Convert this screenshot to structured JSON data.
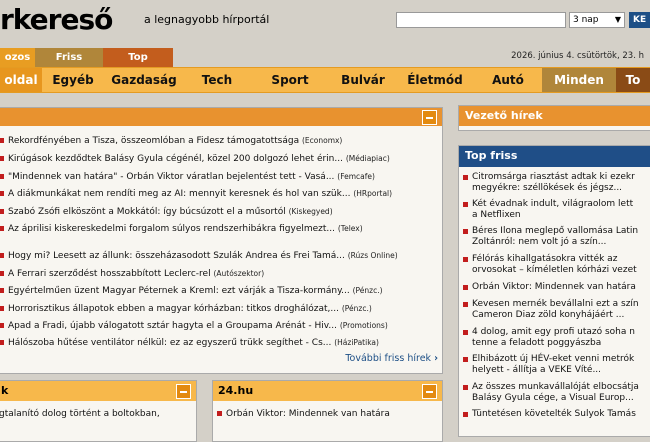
{
  "header": {
    "logo": "rkereső",
    "tagline": "a legnagyobb hírportál",
    "top_note": "hírek itt",
    "search_placeholder": "",
    "days_selected": "3 nap",
    "search_button": "KE"
  },
  "tabs": [
    {
      "label": "ozos",
      "color": "#e89d22"
    },
    {
      "label": "Friss",
      "color": "#b0863a"
    },
    {
      "label": "Top",
      "color": "#c35d1d"
    }
  ],
  "date": "2026. június 4. csütörtök, 23. h",
  "categories": [
    {
      "label": "oldal",
      "active": true
    },
    {
      "label": "Egyéb"
    },
    {
      "label": "Gazdaság"
    },
    {
      "label": "Tech"
    },
    {
      "label": "Sport"
    },
    {
      "label": "Bulvár"
    },
    {
      "label": "Életmód"
    },
    {
      "label": "Autó"
    },
    {
      "label": "Minden",
      "active": true
    },
    {
      "label": "To",
      "dark": true
    }
  ],
  "main_news": [
    {
      "title": "Rekordfényében a Tisza, összeomlóban a Fidesz támogatottsága",
      "source": "(Economx)"
    },
    {
      "title": "Kirúgások kezdődtek Balásy Gyula cégénél, közel 200 dolgozó lehet érin...",
      "source": "(Médiapiac)"
    },
    {
      "title": "\"Mindennek van határa\" - Orbán Viktor váratlan bejelentést tett - Vasá...",
      "source": "(Femcafe)"
    },
    {
      "title": "A diákmunkákat nem rendíti meg az AI: mennyit keresnek és hol van szük...",
      "source": "(HRportal)"
    },
    {
      "title": "Szabó Zsófi elköszönt a Mokkától: így búcsúzott el a műsortól",
      "source": "(Kiskegyed)"
    },
    {
      "title": "Az áprilisi kiskereskedelmi forgalom súlyos rendszerhibákra figyelmezt...",
      "source": "(Telex)"
    },
    {
      "title": "Hogy mi? Leesett az állunk: összeházasodott Szulák Andrea és Frei Tamá...",
      "source": "(Rúzs Online)"
    },
    {
      "title": "A Ferrari szerződést hosszabbított Leclerc-rel",
      "source": "(Autószektor)"
    },
    {
      "title": "Egyértelműen üzent Magyar Péternek a Kreml: ezt várják a Tisza-kormány...",
      "source": "(Pénzc.)"
    },
    {
      "title": "Horrorisztikus állapotok ebben a magyar kórházban: titkos droghálózat,...",
      "source": "(Pénzc.)"
    },
    {
      "title": "Apad a Fradi, újabb válogatott sztár hagyta el a Groupama Arénát - Hiv...",
      "source": "(Promotions)"
    },
    {
      "title": "Hálószoba hűtése ventilátor nélkül: ez az egyszerű trükk segíthet - Cs...",
      "source": "(HáziPatika)"
    }
  ],
  "more_link": "További friss hírek",
  "lower_left": {
    "title": "k",
    "item": "gtalanító dolog történt a boltokban,"
  },
  "lower_mid": {
    "title": "24.hu",
    "item": "Orbán Viktor: Mindennek van határa"
  },
  "vezeto": {
    "title": "Vezető hírek"
  },
  "top_friss": {
    "title": "Top friss",
    "items": [
      [
        "Citromsárga riasztást adtak ki ezekr",
        "megyékre: széllökések és jégsz..."
      ],
      [
        "Két évadnak indult, világraolom lett",
        "a Netflixen"
      ],
      [
        "Béres Ilona meglepő vallomása Latin",
        "Zoltánról: nem volt jó a szín..."
      ],
      [
        "Félórás kihallgatásokra vitték az",
        "orvosokat – kíméletlen kórházi vezet"
      ],
      [
        "Orbán Viktor: Mindennek van határa"
      ],
      [
        "Kevesen mernék bevállalni ezt a szín",
        "Cameron Diaz zöld konyhájáért ..."
      ],
      [
        "4 dolog, amit egy profi utazó soha n",
        "tenne a feladott poggyászba"
      ],
      [
        "Elhibázott új HÉV-eket venni metrók",
        "helyett - állítja a VEKE Víté..."
      ],
      [
        "Az összes munkavállalóját elbocsátja",
        "Balásy Gyula cége, a Visual Europ..."
      ],
      [
        "Tüntetésen követelték Sulyok Tamás"
      ]
    ]
  },
  "colors": {
    "accent_orange": "#f7b84b",
    "panel_header_orange": "#e8922f",
    "top_friss_blue": "#1f4e87",
    "bullet_red": "#c21d1d",
    "link_blue": "#1d4f86"
  }
}
